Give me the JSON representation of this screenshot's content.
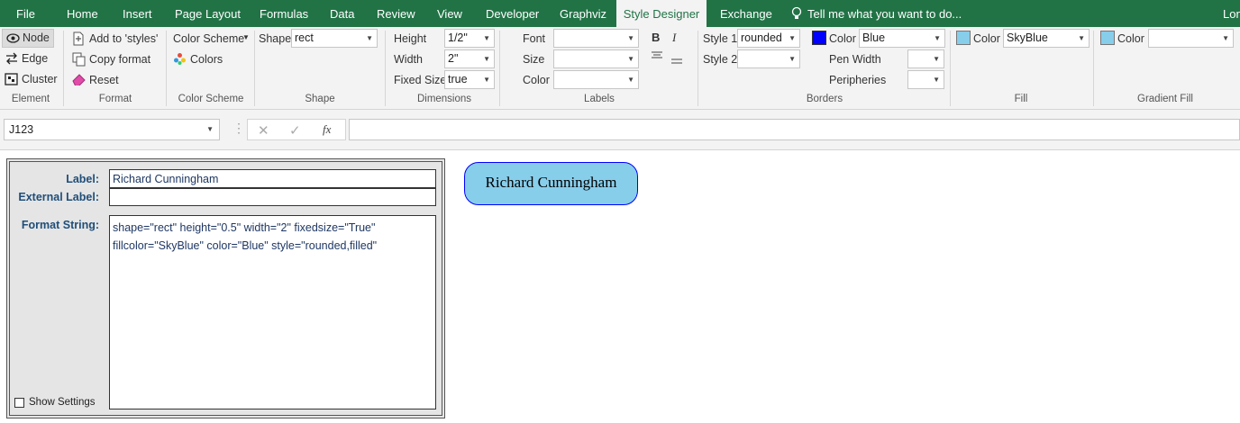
{
  "menu": {
    "items": [
      "File",
      "Home",
      "Insert",
      "Page Layout",
      "Formulas",
      "Data",
      "Review",
      "View",
      "Developer",
      "Graphviz",
      "Style Designer",
      "Exchange"
    ],
    "active": "Style Designer",
    "tell_me": "Tell me what you want to do...",
    "user": "Lon"
  },
  "ribbon": {
    "element": {
      "node": "Node",
      "edge": "Edge",
      "cluster": "Cluster",
      "group": "Element"
    },
    "format": {
      "add": "Add to 'styles'",
      "copy": "Copy format",
      "reset": "Reset",
      "group": "Format"
    },
    "color_scheme": {
      "button": "Color Scheme",
      "colors": "Colors",
      "group": "Color Scheme"
    },
    "shape": {
      "label": "Shape",
      "value": "rect",
      "group": "Shape"
    },
    "dimensions": {
      "height_label": "Height",
      "height": "1/2\"",
      "width_label": "Width",
      "width": "2\"",
      "fixed_label": "Fixed Size",
      "fixed": "true",
      "group": "Dimensions"
    },
    "labels": {
      "font": "Font",
      "size": "Size",
      "color": "Color",
      "bold": "B",
      "italic": "I",
      "group": "Labels"
    },
    "borders": {
      "style1_label": "Style 1",
      "style1": "rounded",
      "style2_label": "Style 2",
      "color_label": "Color",
      "color": "Blue",
      "pen_width": "Pen Width",
      "peripheries": "Peripheries",
      "group": "Borders",
      "swatch": "#0000ff"
    },
    "fill": {
      "color_label": "Color",
      "color": "SkyBlue",
      "group": "Fill",
      "swatch": "#87ceeb"
    },
    "gradient": {
      "color_label": "Color",
      "color": "",
      "group": "Gradient Fill",
      "swatch": "#87ceeb"
    }
  },
  "formula_bar": {
    "name_box": "J123",
    "cancel": "✕",
    "enter": "✓",
    "fx": "fx",
    "formula": ""
  },
  "panel": {
    "label_caption": "Label:",
    "label_value": "Richard Cunningham",
    "external_caption": "External Label:",
    "external_value": "",
    "format_caption": "Format String:",
    "format_value": "shape=\"rect\" height=\"0.5\" width=\"2\" fixedsize=\"True\" fillcolor=\"SkyBlue\" color=\"Blue\" style=\"rounded,filled\"",
    "show_settings": "Show Settings"
  },
  "node": {
    "text": "Richard Cunningham",
    "fill": "#87ceeb",
    "border": "#0000ff"
  }
}
